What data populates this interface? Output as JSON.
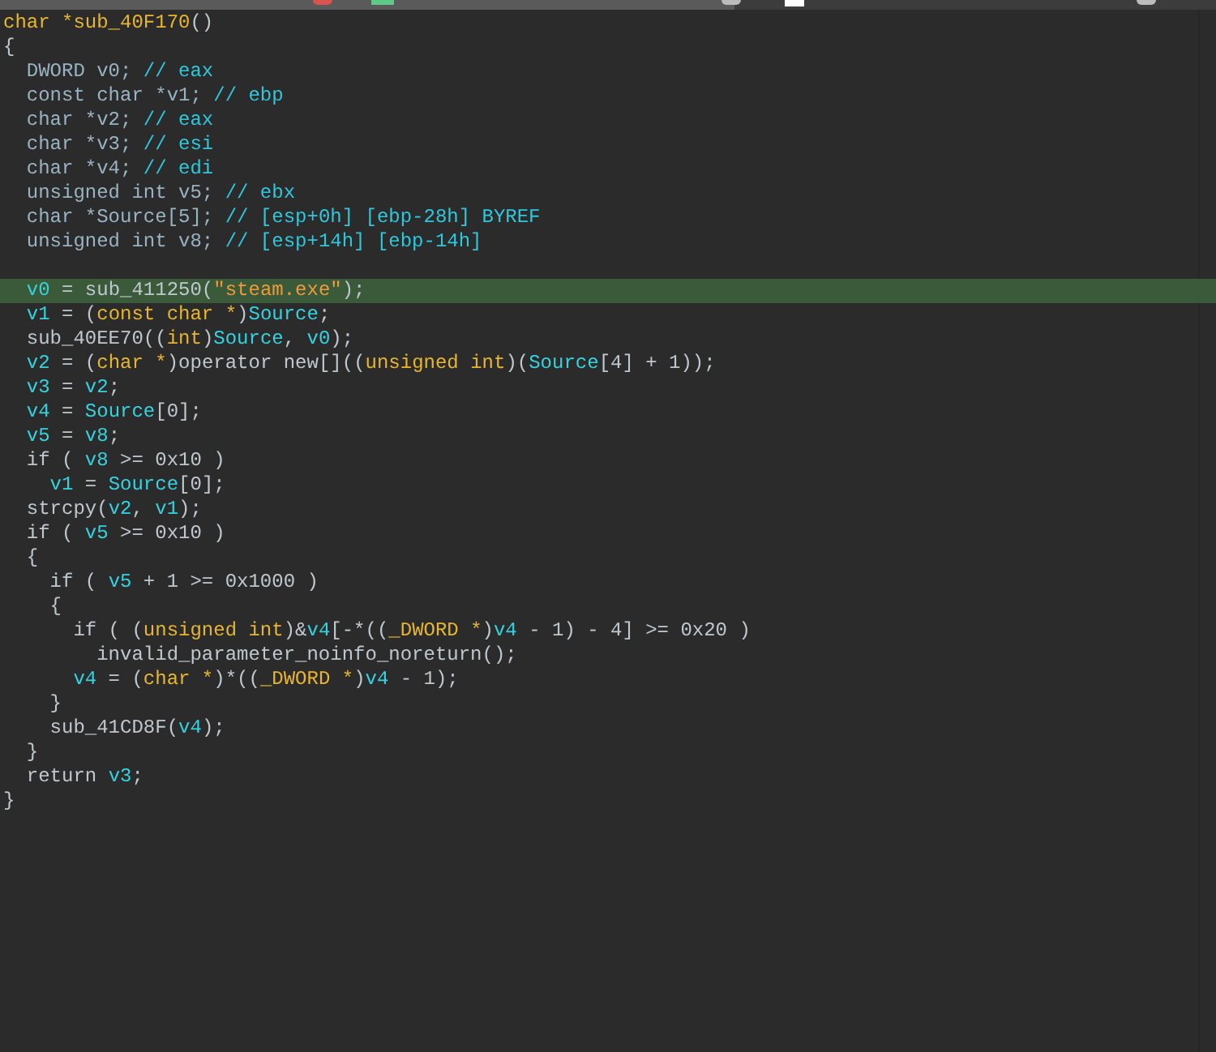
{
  "code": {
    "lines": [
      {
        "highlighted": false,
        "segments": [
          {
            "kind": "type",
            "text": "char *sub_40F170"
          },
          {
            "kind": "plain",
            "text": "()"
          }
        ]
      },
      {
        "highlighted": false,
        "segments": [
          {
            "kind": "plain",
            "text": "{"
          }
        ]
      },
      {
        "highlighted": false,
        "segments": [
          {
            "kind": "decl",
            "text": "  DWORD v0; "
          },
          {
            "kind": "comment",
            "text": "// eax"
          }
        ]
      },
      {
        "highlighted": false,
        "segments": [
          {
            "kind": "decl",
            "text": "  const char *v1; "
          },
          {
            "kind": "comment",
            "text": "// ebp"
          }
        ]
      },
      {
        "highlighted": false,
        "segments": [
          {
            "kind": "decl",
            "text": "  char *v2; "
          },
          {
            "kind": "comment",
            "text": "// eax"
          }
        ]
      },
      {
        "highlighted": false,
        "segments": [
          {
            "kind": "decl",
            "text": "  char *v3; "
          },
          {
            "kind": "comment",
            "text": "// esi"
          }
        ]
      },
      {
        "highlighted": false,
        "segments": [
          {
            "kind": "decl",
            "text": "  char *v4; "
          },
          {
            "kind": "comment",
            "text": "// edi"
          }
        ]
      },
      {
        "highlighted": false,
        "segments": [
          {
            "kind": "decl",
            "text": "  unsigned int v5; "
          },
          {
            "kind": "comment",
            "text": "// ebx"
          }
        ]
      },
      {
        "highlighted": false,
        "segments": [
          {
            "kind": "decl",
            "text": "  char *Source[5]; "
          },
          {
            "kind": "comment",
            "text": "// [esp+0h] [ebp-28h] BYREF"
          }
        ]
      },
      {
        "highlighted": false,
        "segments": [
          {
            "kind": "decl",
            "text": "  unsigned int v8; "
          },
          {
            "kind": "comment",
            "text": "// [esp+14h] [ebp-14h]"
          }
        ]
      },
      {
        "highlighted": false
      },
      {
        "highlighted": true,
        "segments": [
          {
            "kind": "var",
            "text": "  v0"
          },
          {
            "kind": "plain",
            "text": " = sub_411250("
          },
          {
            "kind": "string",
            "text": "\"steam.exe\""
          },
          {
            "kind": "plain",
            "text": ");"
          }
        ]
      },
      {
        "highlighted": false,
        "segments": [
          {
            "kind": "var",
            "text": "  v1"
          },
          {
            "kind": "plain",
            "text": " = ("
          },
          {
            "kind": "type",
            "text": "const char *"
          },
          {
            "kind": "plain",
            "text": ")"
          },
          {
            "kind": "var",
            "text": "Source"
          },
          {
            "kind": "plain",
            "text": ";"
          }
        ]
      },
      {
        "highlighted": false,
        "segments": [
          {
            "kind": "plain",
            "text": "  sub_40EE70(("
          },
          {
            "kind": "type",
            "text": "int"
          },
          {
            "kind": "plain",
            "text": ")"
          },
          {
            "kind": "var",
            "text": "Source"
          },
          {
            "kind": "plain",
            "text": ", "
          },
          {
            "kind": "var",
            "text": "v0"
          },
          {
            "kind": "plain",
            "text": ");"
          }
        ]
      },
      {
        "highlighted": false,
        "segments": [
          {
            "kind": "var",
            "text": "  v2"
          },
          {
            "kind": "plain",
            "text": " = ("
          },
          {
            "kind": "type",
            "text": "char *"
          },
          {
            "kind": "plain",
            "text": ")operator new[](("
          },
          {
            "kind": "type",
            "text": "unsigned int"
          },
          {
            "kind": "plain",
            "text": ")("
          },
          {
            "kind": "var",
            "text": "Source"
          },
          {
            "kind": "plain",
            "text": "[4] + 1));"
          }
        ]
      },
      {
        "highlighted": false,
        "segments": [
          {
            "kind": "var",
            "text": "  v3"
          },
          {
            "kind": "plain",
            "text": " = "
          },
          {
            "kind": "var",
            "text": "v2"
          },
          {
            "kind": "plain",
            "text": ";"
          }
        ]
      },
      {
        "highlighted": false,
        "segments": [
          {
            "kind": "var",
            "text": "  v4"
          },
          {
            "kind": "plain",
            "text": " = "
          },
          {
            "kind": "var",
            "text": "Source"
          },
          {
            "kind": "plain",
            "text": "[0];"
          }
        ]
      },
      {
        "highlighted": false,
        "segments": [
          {
            "kind": "var",
            "text": "  v5"
          },
          {
            "kind": "plain",
            "text": " = "
          },
          {
            "kind": "var",
            "text": "v8"
          },
          {
            "kind": "plain",
            "text": ";"
          }
        ]
      },
      {
        "highlighted": false,
        "segments": [
          {
            "kind": "plain",
            "text": "  if ( "
          },
          {
            "kind": "var",
            "text": "v8"
          },
          {
            "kind": "plain",
            "text": " >= 0x10 )"
          }
        ]
      },
      {
        "highlighted": false,
        "segments": [
          {
            "kind": "var",
            "text": "    v1"
          },
          {
            "kind": "plain",
            "text": " = "
          },
          {
            "kind": "var",
            "text": "Source"
          },
          {
            "kind": "plain",
            "text": "[0];"
          }
        ]
      },
      {
        "highlighted": false,
        "segments": [
          {
            "kind": "plain",
            "text": "  strcpy("
          },
          {
            "kind": "var",
            "text": "v2"
          },
          {
            "kind": "plain",
            "text": ", "
          },
          {
            "kind": "var",
            "text": "v1"
          },
          {
            "kind": "plain",
            "text": ");"
          }
        ]
      },
      {
        "highlighted": false,
        "segments": [
          {
            "kind": "plain",
            "text": "  if ( "
          },
          {
            "kind": "var",
            "text": "v5"
          },
          {
            "kind": "plain",
            "text": " >= 0x10 )"
          }
        ]
      },
      {
        "highlighted": false,
        "segments": [
          {
            "kind": "plain",
            "text": "  {"
          }
        ]
      },
      {
        "highlighted": false,
        "segments": [
          {
            "kind": "plain",
            "text": "    if ( "
          },
          {
            "kind": "var",
            "text": "v5"
          },
          {
            "kind": "plain",
            "text": " + 1 >= 0x1000 )"
          }
        ]
      },
      {
        "highlighted": false,
        "segments": [
          {
            "kind": "plain",
            "text": "    {"
          }
        ]
      },
      {
        "highlighted": false,
        "segments": [
          {
            "kind": "plain",
            "text": "      if ( ("
          },
          {
            "kind": "type",
            "text": "unsigned int"
          },
          {
            "kind": "plain",
            "text": ")&"
          },
          {
            "kind": "var",
            "text": "v4"
          },
          {
            "kind": "plain",
            "text": "[-*(("
          },
          {
            "kind": "type",
            "text": "_DWORD *"
          },
          {
            "kind": "plain",
            "text": ")"
          },
          {
            "kind": "var",
            "text": "v4"
          },
          {
            "kind": "plain",
            "text": " - 1) - 4] >= 0x20 )"
          }
        ]
      },
      {
        "highlighted": false,
        "segments": [
          {
            "kind": "plain",
            "text": "        invalid_parameter_noinfo_noreturn();"
          }
        ]
      },
      {
        "highlighted": false,
        "segments": [
          {
            "kind": "var",
            "text": "      v4"
          },
          {
            "kind": "plain",
            "text": " = ("
          },
          {
            "kind": "type",
            "text": "char *"
          },
          {
            "kind": "plain",
            "text": ")*(("
          },
          {
            "kind": "type",
            "text": "_DWORD *"
          },
          {
            "kind": "plain",
            "text": ")"
          },
          {
            "kind": "var",
            "text": "v4"
          },
          {
            "kind": "plain",
            "text": " - 1);"
          }
        ]
      },
      {
        "highlighted": false,
        "segments": [
          {
            "kind": "plain",
            "text": "    }"
          }
        ]
      },
      {
        "highlighted": false,
        "segments": [
          {
            "kind": "plain",
            "text": "    sub_41CD8F("
          },
          {
            "kind": "var",
            "text": "v4"
          },
          {
            "kind": "plain",
            "text": ");"
          }
        ]
      },
      {
        "highlighted": false,
        "segments": [
          {
            "kind": "plain",
            "text": "  }"
          }
        ]
      },
      {
        "highlighted": false,
        "segments": [
          {
            "kind": "plain",
            "text": "  return "
          },
          {
            "kind": "var",
            "text": "v3"
          },
          {
            "kind": "plain",
            "text": ";"
          }
        ]
      },
      {
        "highlighted": false,
        "segments": [
          {
            "kind": "plain",
            "text": "}"
          }
        ]
      }
    ]
  }
}
